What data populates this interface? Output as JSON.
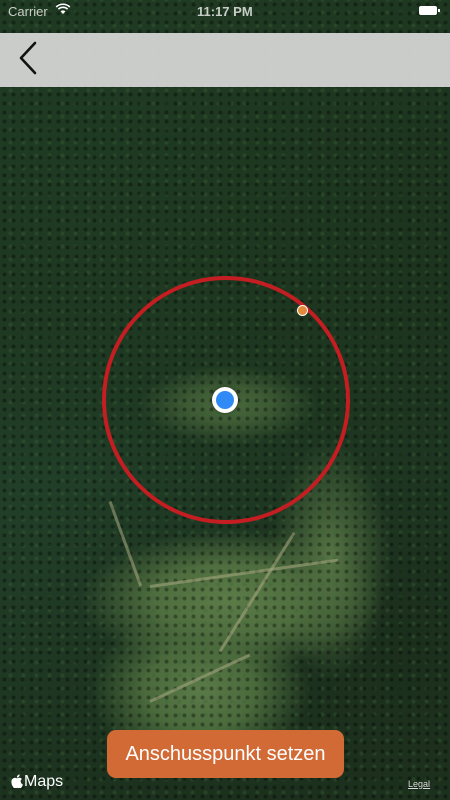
{
  "status_bar": {
    "carrier": "Carrier",
    "time": "11:17 PM"
  },
  "navigation": {
    "back_icon": "chevron-left-icon"
  },
  "map": {
    "type": "satellite",
    "ring_color": "#c41e22",
    "user_location_color": "#2f8af5",
    "handle_color": "#e08a3a",
    "attribution": "Maps",
    "legal_label": "Legal"
  },
  "action": {
    "label": "Anschusspunkt setzen",
    "color": "#d26a36"
  }
}
